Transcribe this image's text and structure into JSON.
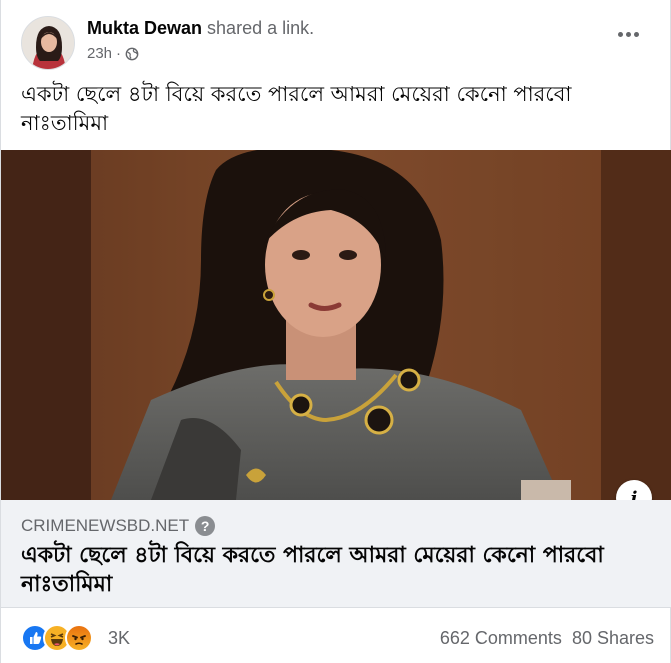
{
  "post": {
    "author": "Mukta Dewan",
    "action": "shared a link.",
    "time": "23h",
    "separator": "·",
    "visibility_icon": "globe-icon",
    "more_icon": "more-dots-icon",
    "text": "একটা ছেলে ৪টা বিয়ে করতে পারলে আমরা মেয়েরা কেনো পারবো নাঃতামিমা"
  },
  "link": {
    "domain": "CRIMENEWSBD.NET",
    "help_icon_label": "?",
    "title": "একটা ছেলে ৪টা বিয়ে করতে পারলে আমরা মেয়েরা কেনো পারবো নাঃতামিমা",
    "info_label": "i"
  },
  "engagement": {
    "reaction_icons": [
      "like-icon",
      "haha-icon",
      "angry-icon"
    ],
    "reaction_count": "3K",
    "comments": "662 Comments",
    "shares": "80 Shares"
  },
  "colors": {
    "text_primary": "#050505",
    "text_secondary": "#65676b",
    "link_box_bg": "#f0f2f5",
    "like_blue": "#1877f2",
    "haha_yellow": "#f7b125",
    "angry_orange": "#e9710f"
  }
}
